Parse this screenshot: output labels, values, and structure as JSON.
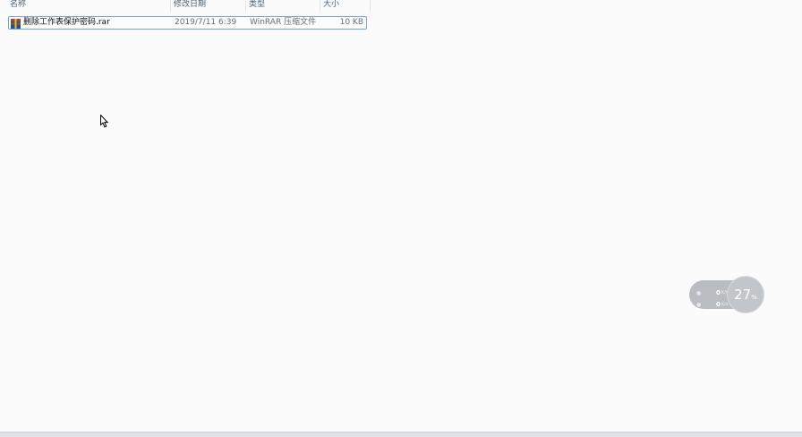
{
  "columns": {
    "name": "名称",
    "date": "修改日期",
    "type": "类型",
    "size": "大小"
  },
  "files": [
    {
      "icon": "winrar-archive-icon",
      "name": "删除工作表保护密码.rar",
      "date": "2019/7/11 6:39",
      "type": "WinRAR 压缩文件",
      "size": "10 KB"
    }
  ],
  "network_monitor": {
    "upload_speed": "0",
    "download_speed": "0",
    "unit": "K/s",
    "percent": "27",
    "percent_sign": "%"
  },
  "colors": {
    "selection_border": "#7da2ce",
    "header_text": "#4c607a",
    "widget_gray": "#b9bdc2"
  }
}
